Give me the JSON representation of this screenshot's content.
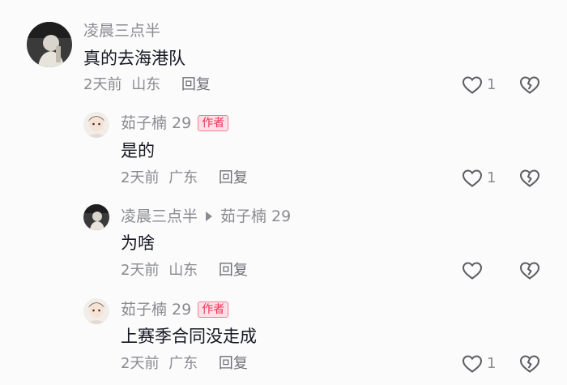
{
  "comments": [
    {
      "username": "凌晨三点半",
      "text": "真的去海港队",
      "time": "2天前",
      "location": "山东",
      "reply_label": "回复",
      "likes": "1"
    },
    {
      "username": "茹子楠 29",
      "badge": "作者",
      "text": "是的",
      "time": "2天前",
      "location": "广东",
      "reply_label": "回复",
      "likes": "1"
    },
    {
      "username": "凌晨三点半",
      "reply_to": "茹子楠 29",
      "text": "为啥",
      "time": "2天前",
      "location": "山东",
      "reply_label": "回复",
      "likes": ""
    },
    {
      "username": "茹子楠 29",
      "badge": "作者",
      "text": "上赛季合同没走成",
      "time": "2天前",
      "location": "广东",
      "reply_label": "回复",
      "likes": "1"
    }
  ],
  "icons": {
    "like": "heart-outline-icon",
    "dislike": "broken-heart-icon"
  },
  "colors": {
    "username": "#8a8b91",
    "badge_text": "#f0315a",
    "badge_bg": "#fde0e6"
  }
}
